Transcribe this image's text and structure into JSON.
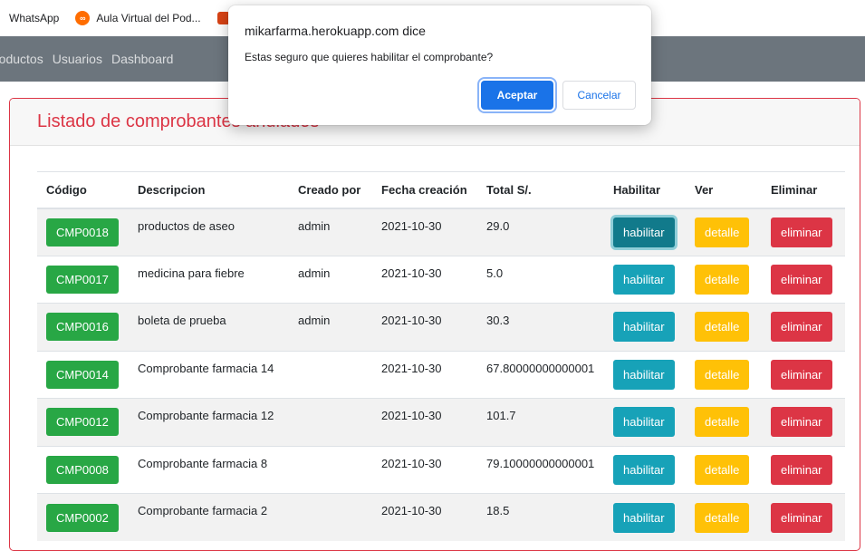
{
  "bookmarks": [
    {
      "label": "WhatsApp",
      "icon": "whatsapp-icon"
    },
    {
      "label": "Aula Virtual del Pod...",
      "icon": "aula-virtual-icon"
    }
  ],
  "navbar": {
    "links": [
      "roductos",
      "Usuarios",
      "Dashboard"
    ]
  },
  "card": {
    "title": "Listado de comprobantes anulados"
  },
  "table": {
    "headers": [
      "Código",
      "Descripcion",
      "Creado por",
      "Fecha creación",
      "Total S/.",
      "Habilitar",
      "Ver",
      "Eliminar"
    ],
    "rows": [
      {
        "code": "CMP0018",
        "desc": "productos de aseo",
        "creator": "admin",
        "date": "2021-10-30",
        "total": "29.0"
      },
      {
        "code": "CMP0017",
        "desc": "medicina para fiebre",
        "creator": "admin",
        "date": "2021-10-30",
        "total": "5.0"
      },
      {
        "code": "CMP0016",
        "desc": "boleta de prueba",
        "creator": "admin",
        "date": "2021-10-30",
        "total": "30.3"
      },
      {
        "code": "CMP0014",
        "desc": "Comprobante farmacia 14",
        "creator": "",
        "date": "2021-10-30",
        "total": "67.80000000000001"
      },
      {
        "code": "CMP0012",
        "desc": "Comprobante farmacia 12",
        "creator": "",
        "date": "2021-10-30",
        "total": "101.7"
      },
      {
        "code": "CMP0008",
        "desc": "Comprobante farmacia 8",
        "creator": "",
        "date": "2021-10-30",
        "total": "79.10000000000001"
      },
      {
        "code": "CMP0002",
        "desc": "Comprobante farmacia 2",
        "creator": "",
        "date": "2021-10-30",
        "total": "18.5"
      }
    ],
    "btn_enable": "habilitar",
    "btn_detail": "detalle",
    "btn_delete": "eliminar"
  },
  "dialog": {
    "title": "mikarfarma.herokuapp.com dice",
    "message": "Estas seguro que quieres habilitar el comprobante?",
    "ok": "Aceptar",
    "cancel": "Cancelar"
  },
  "colors": {
    "navbar": "#6c757d",
    "accent_red": "#dc3545",
    "code_badge": "#28a745",
    "info": "#17a2b8",
    "warning": "#ffc107",
    "dialog_primary": "#1a73e8"
  }
}
